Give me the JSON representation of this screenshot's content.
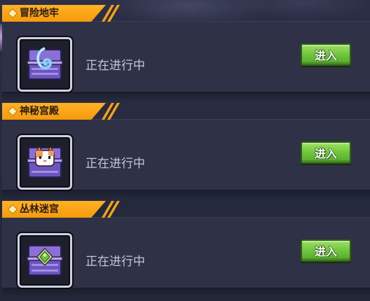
{
  "colors": {
    "tag_orange": "#f5a314",
    "button_green": "#72c43c",
    "panel": "#2f3146",
    "status_text": "#c4c7d6"
  },
  "dungeons": [
    {
      "title": "冒险地牢",
      "status": "正在进行中",
      "button": "进入",
      "chest_icon": "chest-swirl-icon"
    },
    {
      "title": "神秘宫殿",
      "status": "正在进行中",
      "button": "进入",
      "chest_icon": "chest-cat-icon"
    },
    {
      "title": "丛林迷宫",
      "status": "正在进行中",
      "button": "进入",
      "chest_icon": "chest-gem-icon"
    }
  ]
}
